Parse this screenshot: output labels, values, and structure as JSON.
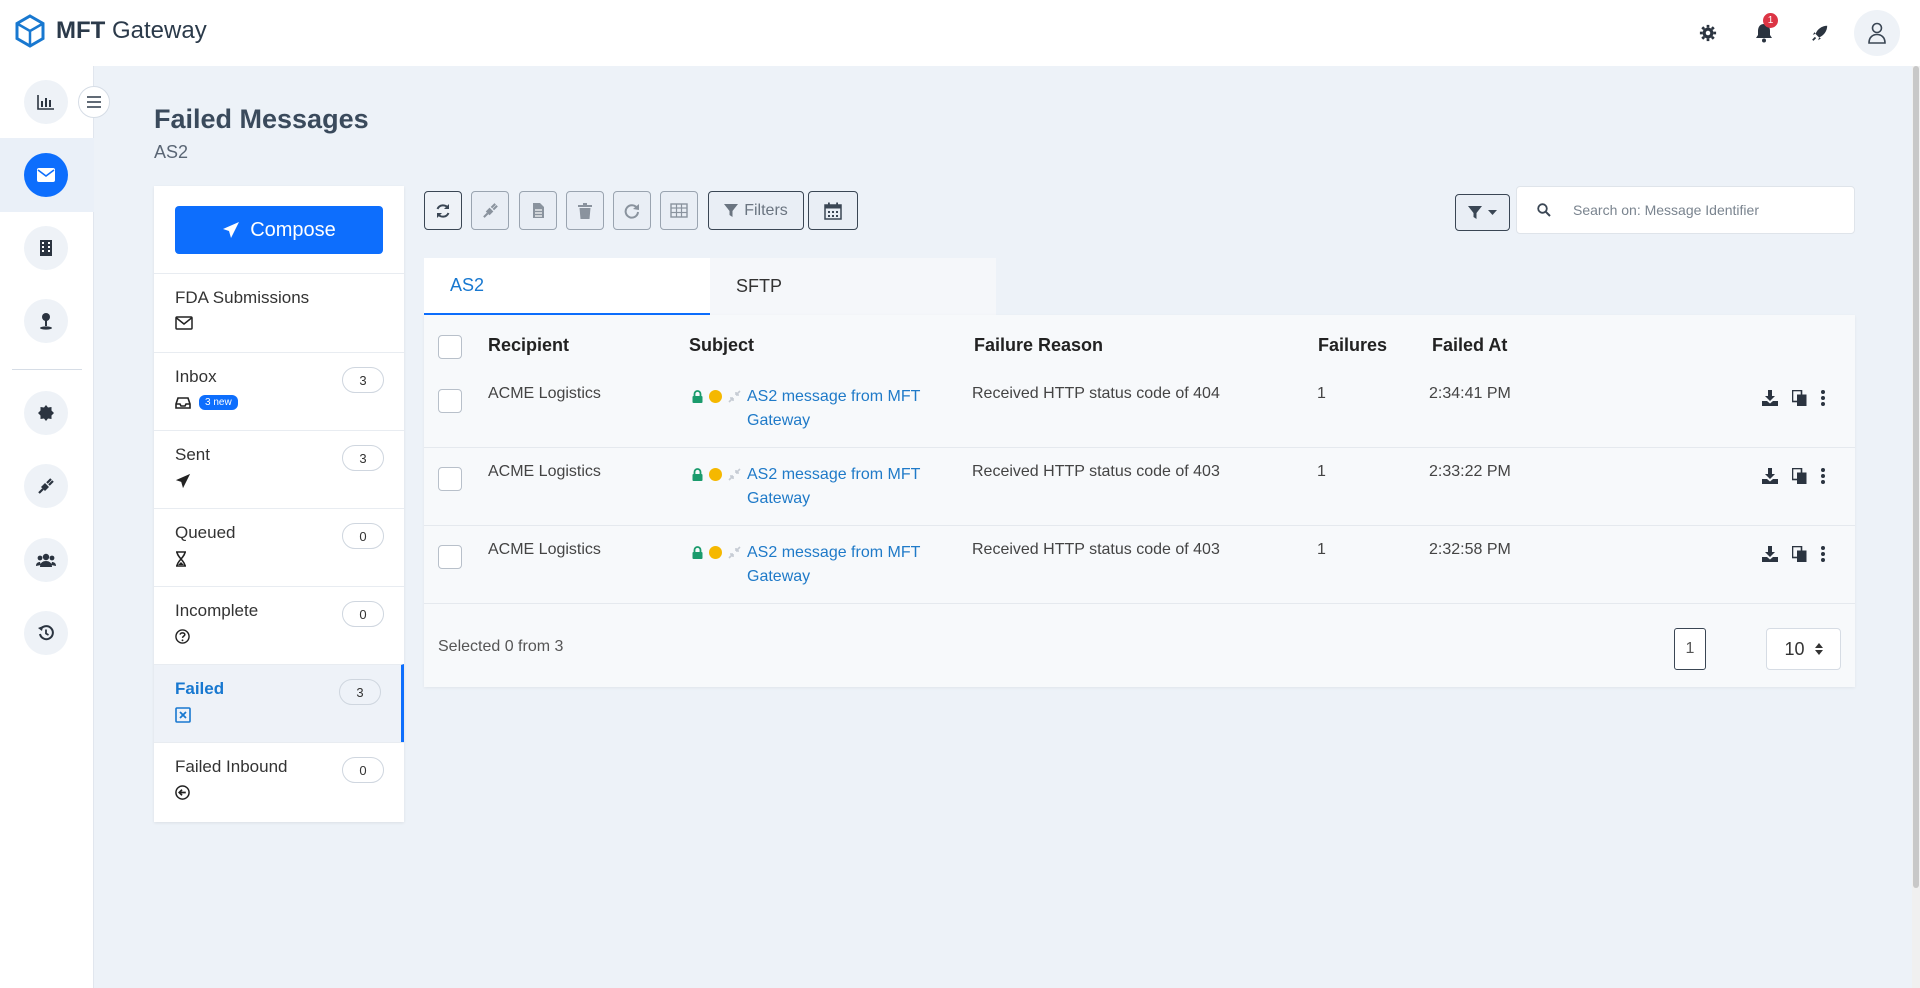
{
  "app": {
    "name_bold": "MFT",
    "name_rest": " Gateway",
    "notification_count": "1"
  },
  "page": {
    "title": "Failed Messages",
    "subtitle": "AS2"
  },
  "compose_label": "Compose",
  "folders": [
    {
      "name": "FDA Submissions",
      "count": "",
      "icon": "envelope-icon"
    },
    {
      "name": "Inbox",
      "count": "3",
      "badge": "3 new",
      "icon": "inbox-icon"
    },
    {
      "name": "Sent",
      "count": "3",
      "icon": "paper-plane-icon"
    },
    {
      "name": "Queued",
      "count": "0",
      "icon": "hourglass-icon"
    },
    {
      "name": "Incomplete",
      "count": "0",
      "icon": "question-circle-icon"
    },
    {
      "name": "Failed",
      "count": "3",
      "icon": "x-square-icon"
    },
    {
      "name": "Failed Inbound",
      "count": "0",
      "icon": "arrow-circle-left-icon"
    }
  ],
  "toolbar": {
    "filters_label": "Filters"
  },
  "search": {
    "placeholder": "Search on: Message Identifier"
  },
  "tabs": [
    {
      "label": "AS2"
    },
    {
      "label": "SFTP"
    }
  ],
  "table": {
    "columns": [
      "Recipient",
      "Subject",
      "Failure Reason",
      "Failures",
      "Failed At"
    ],
    "rows": [
      {
        "recipient": "ACME Logistics",
        "subject": "AS2 message from MFT Gateway",
        "reason": "Received HTTP status code of 404",
        "failures": "1",
        "failed_at": "2:34:41 PM"
      },
      {
        "recipient": "ACME Logistics",
        "subject": "AS2 message from MFT Gateway",
        "reason": "Received HTTP status code of 403",
        "failures": "1",
        "failed_at": "2:33:22 PM"
      },
      {
        "recipient": "ACME Logistics",
        "subject": "AS2 message from MFT Gateway",
        "reason": "Received HTTP status code of 403",
        "failures": "1",
        "failed_at": "2:32:58 PM"
      }
    ],
    "selected_text": "Selected 0 from 3",
    "page": "1",
    "per_page": "10"
  },
  "colors": {
    "primary": "#0d6efd",
    "link": "#1f7ac8",
    "lock": "#1a9b6c",
    "warning_dot": "#f5b800",
    "badge_red": "#dc3545"
  }
}
